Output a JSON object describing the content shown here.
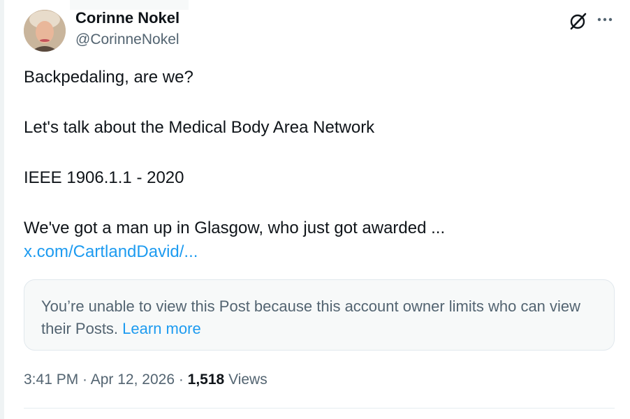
{
  "author": {
    "name": "Corinne Nokel",
    "handle": "@CorinneNokel"
  },
  "icons": {
    "grok": "grok-icon",
    "more": "more-icon"
  },
  "post": {
    "line1": "Backpedaling, are we?",
    "line2": "Let's talk about the Medical Body Area Network",
    "line3": "IEEE 1906.1.1 - 2020",
    "line4": "We've got a man up in Glasgow, who just got awarded ...",
    "link": "x.com/CartlandDavid/..."
  },
  "notice": {
    "text": "You’re unable to view this Post because this account owner limits who can view their Posts.",
    "learn_more": "Learn more"
  },
  "meta": {
    "time": "3:41 PM",
    "separator1": " · ",
    "date": "Apr 12, 2026",
    "separator2": " · ",
    "views_count": "1,518",
    "views_label": " Views"
  },
  "colors": {
    "accent": "#1d9bf0",
    "secondary_text": "#536471",
    "primary_text": "#0f1419"
  }
}
